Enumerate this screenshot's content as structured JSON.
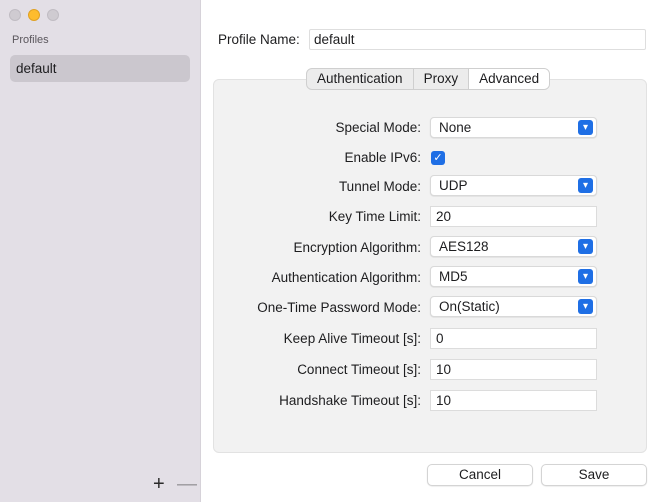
{
  "sidebar": {
    "title": "Profiles",
    "items": [
      {
        "label": "default"
      }
    ],
    "add_label": "+",
    "remove_label": "—"
  },
  "profile": {
    "label": "Profile Name:",
    "value": "default"
  },
  "tabs": [
    {
      "label": "Authentication",
      "active": false
    },
    {
      "label": "Proxy",
      "active": false
    },
    {
      "label": "Advanced",
      "active": true
    }
  ],
  "form": {
    "special_mode": {
      "label": "Special Mode:",
      "value": "None"
    },
    "enable_ipv6": {
      "label": "Enable IPv6:",
      "checked": true
    },
    "tunnel_mode": {
      "label": "Tunnel Mode:",
      "value": "UDP"
    },
    "key_time_limit": {
      "label": "Key Time Limit:",
      "value": "20"
    },
    "encryption_algorithm": {
      "label": "Encryption Algorithm:",
      "value": "AES128"
    },
    "authentication_algorithm": {
      "label": "Authentication Algorithm:",
      "value": "MD5"
    },
    "otp_mode": {
      "label": "One-Time Password Mode:",
      "value": "On(Static)"
    },
    "keep_alive_timeout": {
      "label": "Keep Alive Timeout [s]:",
      "value": "0"
    },
    "connect_timeout": {
      "label": "Connect Timeout [s]:",
      "value": "10"
    },
    "handshake_timeout": {
      "label": "Handshake Timeout [s]:",
      "value": "10"
    }
  },
  "buttons": {
    "cancel": "Cancel",
    "save": "Save"
  },
  "colors": {
    "accent": "#1f6fe5",
    "sidebar_bg": "#e3dfe6",
    "selection": "#cbc7ce",
    "traffic_minimize": "#febc2e"
  },
  "icons": {
    "dropdown": "chevron-updown-icon",
    "checkbox": "checkmark-icon"
  }
}
